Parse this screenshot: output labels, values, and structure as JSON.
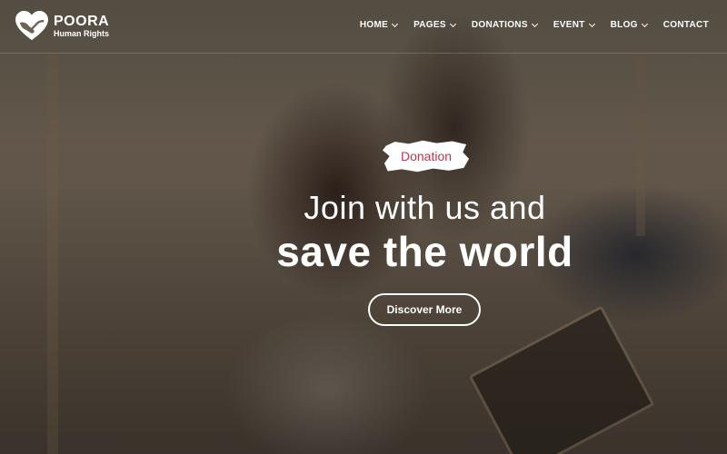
{
  "brand": {
    "name": "POORA",
    "tagline": "Human Rights"
  },
  "nav": {
    "items": [
      {
        "label": "HOME",
        "dropdown": true
      },
      {
        "label": "PAGES",
        "dropdown": true
      },
      {
        "label": "DONATIONS",
        "dropdown": true
      },
      {
        "label": "EVENT",
        "dropdown": true
      },
      {
        "label": "BLOG",
        "dropdown": true
      },
      {
        "label": "CONTACT",
        "dropdown": false
      }
    ]
  },
  "hero": {
    "tag": "Donation",
    "line1": "Join with us and",
    "line2": "save the world",
    "button": "Discover More"
  },
  "colors": {
    "accent": "#c8304a",
    "text": "#ffffff"
  },
  "icons": {
    "logo": "heart-hands-icon",
    "dropdown": "chevron-down-icon"
  }
}
